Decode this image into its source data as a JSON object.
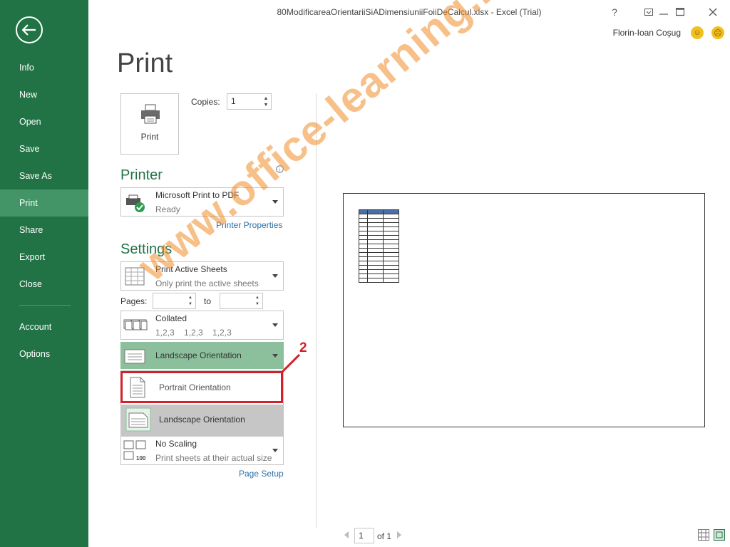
{
  "window": {
    "title": "80ModificareaOrientariiSiADimensiuniiFoiiDeCalcul.xlsx - Excel (Trial)",
    "help": "?",
    "user": "Florin-Ioan Coşug"
  },
  "sidebar": {
    "items": [
      {
        "label": "Info"
      },
      {
        "label": "New"
      },
      {
        "label": "Open"
      },
      {
        "label": "Save"
      },
      {
        "label": "Save As"
      },
      {
        "label": "Print"
      },
      {
        "label": "Share"
      },
      {
        "label": "Export"
      },
      {
        "label": "Close"
      },
      {
        "label": "Account"
      },
      {
        "label": "Options"
      }
    ],
    "active": "Print"
  },
  "page": {
    "title": "Print"
  },
  "print": {
    "button_label": "Print",
    "copies_label": "Copies:",
    "copies_value": "1"
  },
  "printer": {
    "heading": "Printer",
    "name": "Microsoft Print to PDF",
    "status": "Ready",
    "properties_link": "Printer Properties"
  },
  "settings": {
    "heading": "Settings",
    "sheets": {
      "title": "Print Active Sheets",
      "subtitle": "Only print the active sheets"
    },
    "pages_label": "Pages:",
    "to_label": "to",
    "collated": {
      "title": "Collated",
      "subtitle": "1,2,3    1,2,3    1,2,3"
    },
    "orientation": {
      "current": "Landscape Orientation",
      "options": [
        "Portrait Orientation",
        "Landscape Orientation"
      ],
      "selected": "Landscape Orientation"
    },
    "scaling": {
      "title": "No Scaling",
      "subtitle": "Print sheets at their actual size"
    },
    "page_setup_link": "Page Setup"
  },
  "annotation": {
    "callout": "2",
    "color": "#d3202a"
  },
  "watermark": "www.office-learning.ro",
  "preview": {
    "current_page": "1",
    "of_pages": "of 1"
  },
  "colors": {
    "accent": "#217346",
    "accent_active": "#439467"
  }
}
